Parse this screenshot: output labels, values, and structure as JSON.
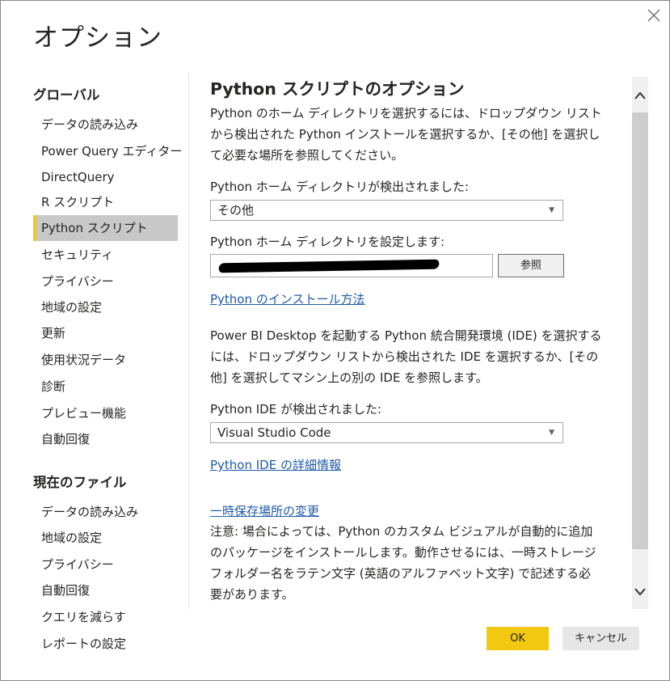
{
  "dialog": {
    "title": "オプション"
  },
  "nav": {
    "global_heading": "グローバル",
    "global_items": [
      "データの読み込み",
      "Power Query エディター",
      "DirectQuery",
      "R スクリプト",
      "Python スクリプト",
      "セキュリティ",
      "プライバシー",
      "地域の設定",
      "更新",
      "使用状況データ",
      "診断",
      "プレビュー機能",
      "自動回復"
    ],
    "current_heading": "現在のファイル",
    "current_items": [
      "データの読み込み",
      "地域の設定",
      "プライバシー",
      "自動回復",
      "クエリを減らす",
      "レポートの設定"
    ],
    "selected": "Python スクリプト"
  },
  "content": {
    "title": "Python スクリプトのオプション",
    "intro": "Python のホーム ディレクトリを選択するには、ドロップダウン リストから検出された Python インストールを選択するか、[その他] を選択して必要な場所を参照してください。",
    "home_detected_label": "Python ホーム ディレクトリが検出されました:",
    "home_detected_value": "その他",
    "home_set_label": "Python ホーム ディレクトリを設定します:",
    "browse_label": "参照",
    "install_link": "Python のインストール方法",
    "ide_intro": "Power BI Desktop を起動する Python 統合開発環境 (IDE) を選択するには、ドロップダウン リストから検出された IDE を選択するか、[その他] を選択してマシン上の別の IDE を参照します。",
    "ide_detected_label": "Python IDE が検出されました:",
    "ide_detected_value": "Visual Studio Code",
    "ide_link": "Python IDE の詳細情報",
    "temp_link": "一時保存場所の変更",
    "note": "注意: 場合によっては、Python のカスタム ビジュアルが自動的に追加のパッケージをインストールします。動作させるには、一時ストレージ フォルダー名をラテン文字 (英語のアルファベット文字) で記述する必要があります。"
  },
  "footer": {
    "ok_label": "OK",
    "cancel_label": "キャンセル"
  },
  "colors": {
    "accent": "#f2c811",
    "link": "#1e5aa8",
    "selected_bg": "#c8c8c8"
  }
}
